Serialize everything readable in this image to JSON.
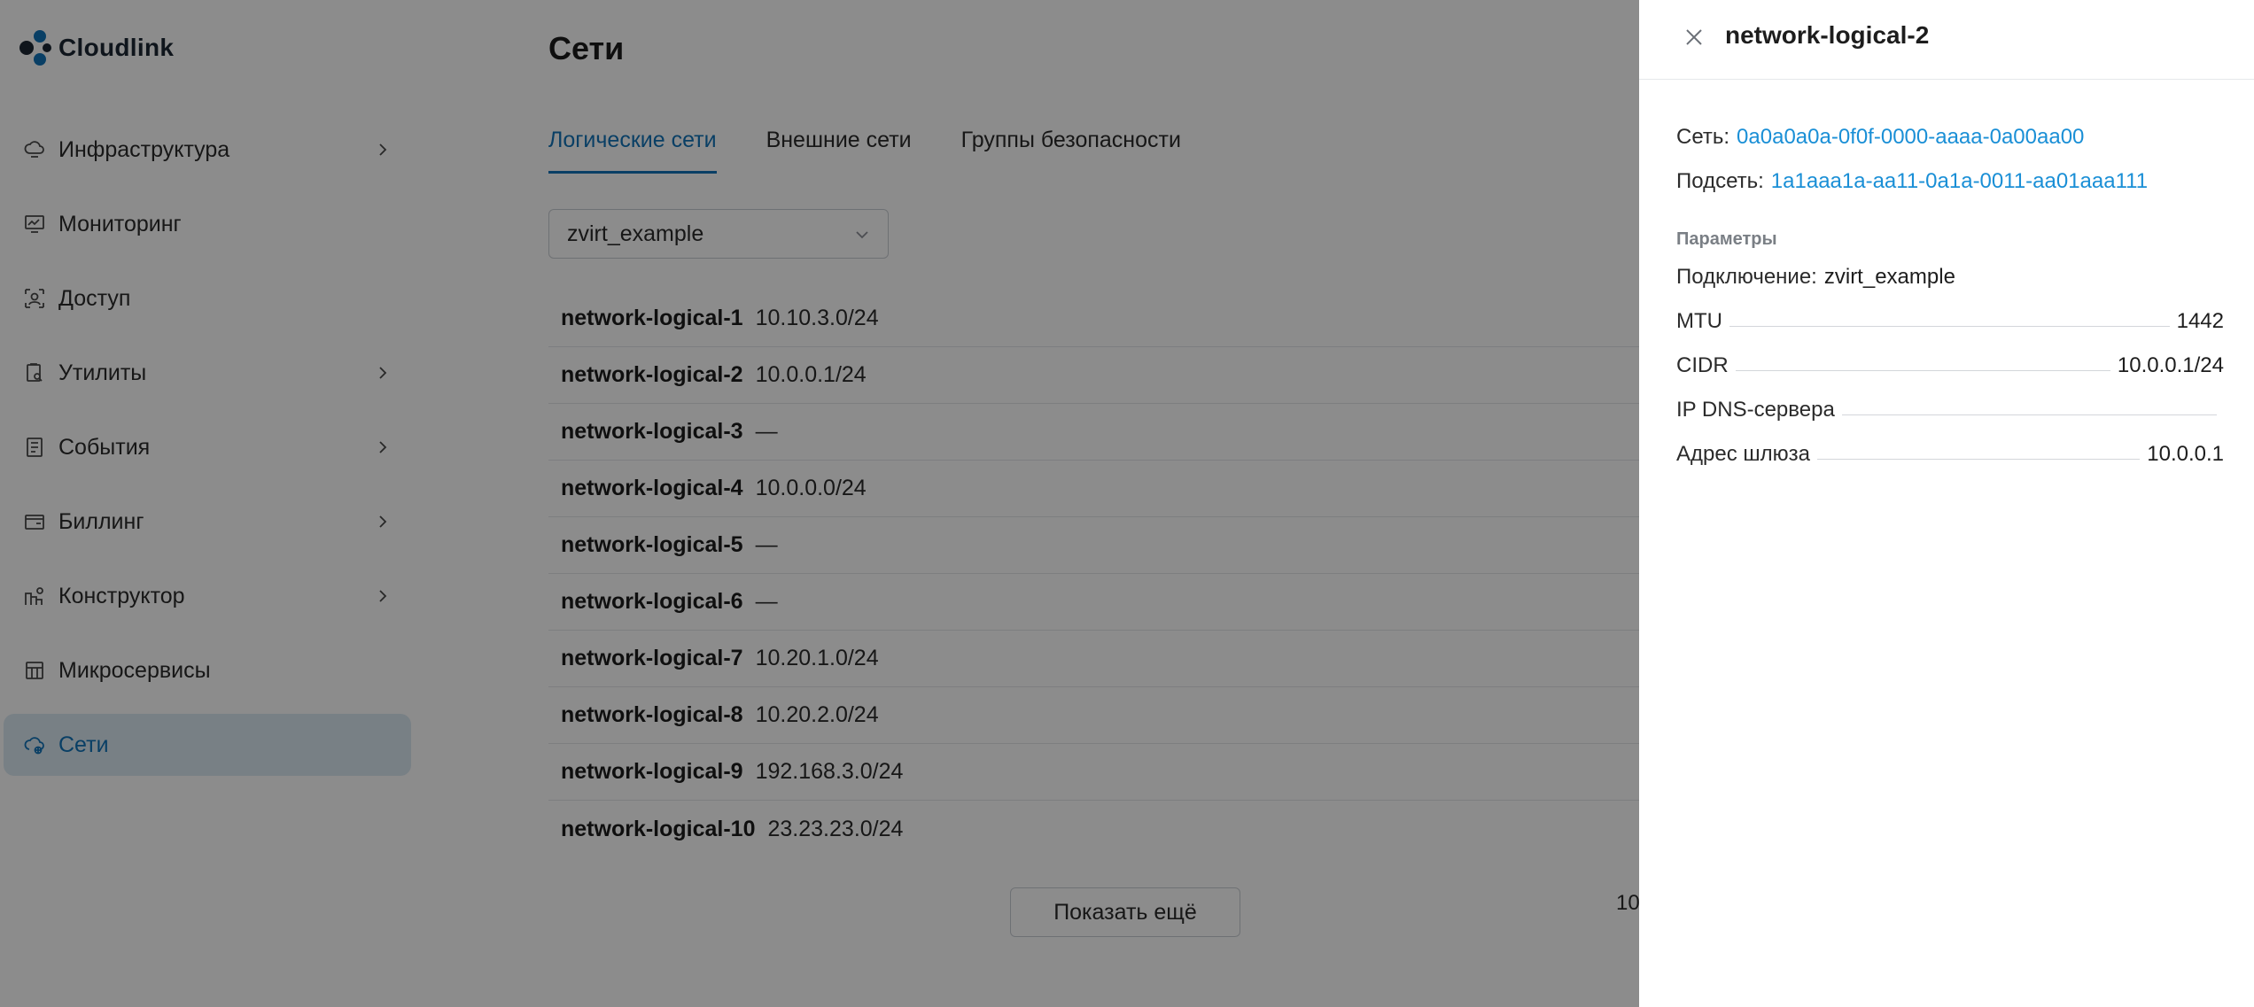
{
  "app": {
    "name": "Cloudlink"
  },
  "sidebar": {
    "items": [
      {
        "label": "Инфраструктура",
        "icon": "cloud-server-icon",
        "has_chevron": true,
        "active": false
      },
      {
        "label": "Мониторинг",
        "icon": "monitor-chart-icon",
        "has_chevron": false,
        "active": false
      },
      {
        "label": "Доступ",
        "icon": "users-access-icon",
        "has_chevron": false,
        "active": false
      },
      {
        "label": "Утилиты",
        "icon": "utilities-icon",
        "has_chevron": true,
        "active": false
      },
      {
        "label": "События",
        "icon": "events-list-icon",
        "has_chevron": true,
        "active": false
      },
      {
        "label": "Биллинг",
        "icon": "wallet-icon",
        "has_chevron": true,
        "active": false
      },
      {
        "label": "Конструктор",
        "icon": "constructor-icon",
        "has_chevron": true,
        "active": false
      },
      {
        "label": "Микросервисы",
        "icon": "microservices-icon",
        "has_chevron": false,
        "active": false
      },
      {
        "label": "Сети",
        "icon": "network-cloud-icon",
        "has_chevron": false,
        "active": true
      }
    ]
  },
  "main": {
    "title": "Сети",
    "tabs": [
      {
        "label": "Логические сети",
        "active": true
      },
      {
        "label": "Внешние сети",
        "active": false
      },
      {
        "label": "Группы безопасности",
        "active": false
      }
    ],
    "connection_select": {
      "value": "zvirt_example"
    },
    "networks": [
      {
        "name": "network-logical-1",
        "cidr": "10.10.3.0/24"
      },
      {
        "name": "network-logical-2",
        "cidr": "10.0.0.1/24"
      },
      {
        "name": "network-logical-3",
        "cidr": "—"
      },
      {
        "name": "network-logical-4",
        "cidr": "10.0.0.0/24"
      },
      {
        "name": "network-logical-5",
        "cidr": "—"
      },
      {
        "name": "network-logical-6",
        "cidr": "—"
      },
      {
        "name": "network-logical-7",
        "cidr": "10.20.1.0/24"
      },
      {
        "name": "network-logical-8",
        "cidr": "10.20.2.0/24"
      },
      {
        "name": "network-logical-9",
        "cidr": "192.168.3.0/24"
      },
      {
        "name": "network-logical-10",
        "cidr": "23.23.23.0/24"
      }
    ],
    "show_more_label": "Показать ещё",
    "pager_partial": "10"
  },
  "drawer": {
    "title": "network-logical-2",
    "network": {
      "label": "Сеть:",
      "value": "0a0a0a0a-0f0f-0000-aaaa-0a00aa00"
    },
    "subnet": {
      "label": "Подсеть:",
      "value": "1a1aaa1a-aa11-0a1a-0011-aa01aaa111"
    },
    "params_title": "Параметры",
    "connection": {
      "label": "Подключение:",
      "value": "zvirt_example"
    },
    "params": [
      {
        "label": "MTU",
        "value": "1442"
      },
      {
        "label": "CIDR",
        "value": "10.0.0.1/24"
      },
      {
        "label": "IP DNS-сервера",
        "value": ""
      },
      {
        "label": "Адрес шлюза",
        "value": "10.0.0.1"
      }
    ]
  },
  "colors": {
    "accent": "#1273b8",
    "link": "#1a8fd6",
    "active_nav_bg": "#dbe9f3",
    "overlay": "rgba(0,0,0,0.45)"
  }
}
